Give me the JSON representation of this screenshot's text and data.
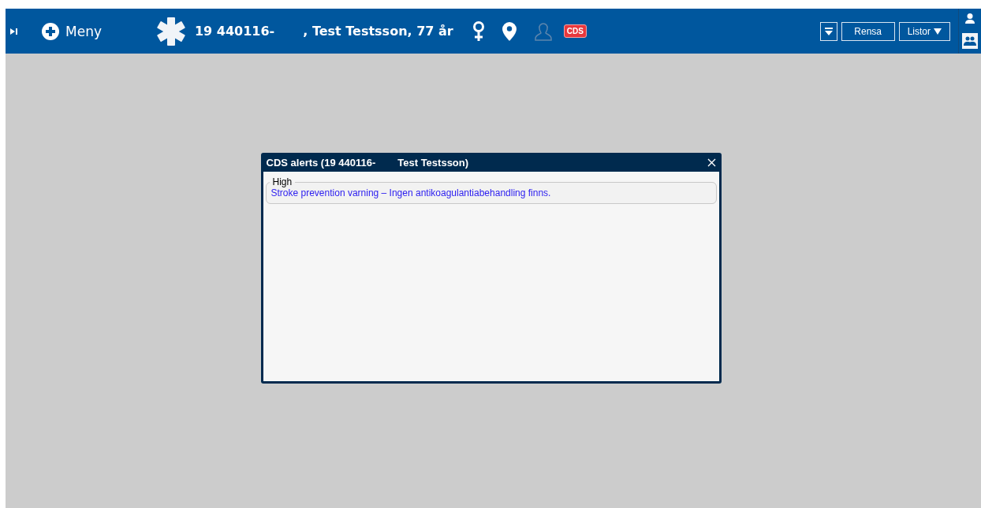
{
  "header": {
    "menu_label": "Meny",
    "patient_id": "19 440116-",
    "patient_name": ", Test Testsson,  77 år",
    "cds_badge": "CDS",
    "buttons": [
      {
        "label": "Rensa"
      },
      {
        "label": "Listor"
      }
    ]
  },
  "dialog": {
    "title_id": "CDS alerts (19 440116-",
    "title_name": "Test Testsson)",
    "groups": [
      {
        "label": "High",
        "alerts": [
          "Stroke prevention varning – Ingen antikoagulantiabehandling finns."
        ]
      }
    ]
  }
}
